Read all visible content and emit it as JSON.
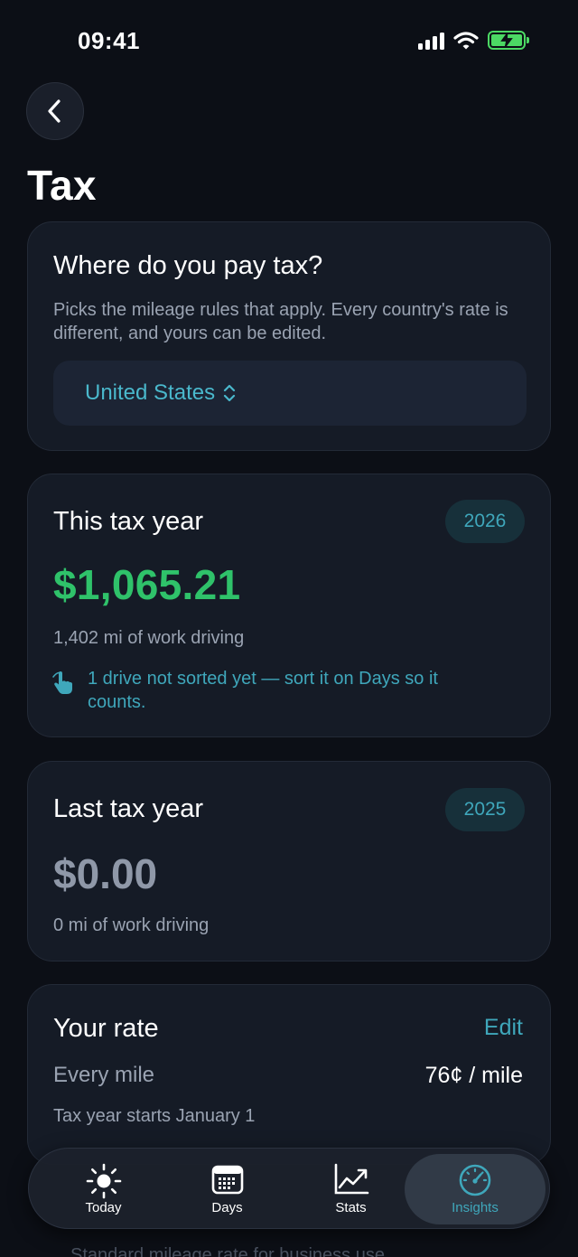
{
  "status_bar": {
    "time": "09:41"
  },
  "header": {
    "title": "Tax"
  },
  "country_card": {
    "title": "Where do you pay tax?",
    "description": "Picks the mileage rules that apply. Every country's rate is different, and yours can be edited.",
    "selected_country": "United States"
  },
  "this_year": {
    "title": "This tax year",
    "year": "2026",
    "amount": "$1,065.21",
    "miles": "1,402 mi of work driving",
    "note": "1 drive not sorted yet — sort it on Days so it counts."
  },
  "last_year": {
    "title": "Last tax year",
    "year": "2025",
    "amount": "$0.00",
    "miles": "0 mi of work driving"
  },
  "rate": {
    "title": "Your rate",
    "edit_label": "Edit",
    "label": "Every mile",
    "value": "76¢ / mile",
    "tax_year_start": "Tax year starts January 1"
  },
  "peek_text": "Standard mileage rate for business use",
  "tab_bar": {
    "tabs": [
      {
        "label": "Today",
        "icon": "sun-icon"
      },
      {
        "label": "Days",
        "icon": "calendar-icon"
      },
      {
        "label": "Stats",
        "icon": "chart-line-icon"
      },
      {
        "label": "Insights",
        "icon": "gauge-icon"
      }
    ],
    "active": "Insights"
  },
  "colors": {
    "background": "#0c0f16",
    "card": "#151b26",
    "accent": "#3fa7bb",
    "money_green": "#2fc26a",
    "battery_green": "#4cd964"
  }
}
